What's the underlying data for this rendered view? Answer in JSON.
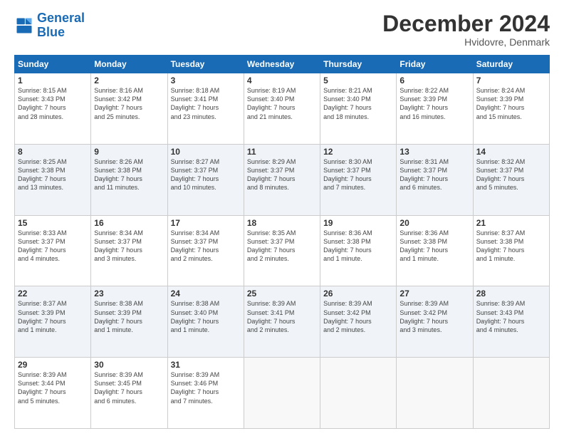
{
  "header": {
    "logo_line1": "General",
    "logo_line2": "Blue",
    "month_title": "December 2024",
    "location": "Hvidovre, Denmark"
  },
  "weekdays": [
    "Sunday",
    "Monday",
    "Tuesday",
    "Wednesday",
    "Thursday",
    "Friday",
    "Saturday"
  ],
  "weeks": [
    [
      {
        "day": "1",
        "info": "Sunrise: 8:15 AM\nSunset: 3:43 PM\nDaylight: 7 hours\nand 28 minutes."
      },
      {
        "day": "2",
        "info": "Sunrise: 8:16 AM\nSunset: 3:42 PM\nDaylight: 7 hours\nand 25 minutes."
      },
      {
        "day": "3",
        "info": "Sunrise: 8:18 AM\nSunset: 3:41 PM\nDaylight: 7 hours\nand 23 minutes."
      },
      {
        "day": "4",
        "info": "Sunrise: 8:19 AM\nSunset: 3:40 PM\nDaylight: 7 hours\nand 21 minutes."
      },
      {
        "day": "5",
        "info": "Sunrise: 8:21 AM\nSunset: 3:40 PM\nDaylight: 7 hours\nand 18 minutes."
      },
      {
        "day": "6",
        "info": "Sunrise: 8:22 AM\nSunset: 3:39 PM\nDaylight: 7 hours\nand 16 minutes."
      },
      {
        "day": "7",
        "info": "Sunrise: 8:24 AM\nSunset: 3:39 PM\nDaylight: 7 hours\nand 15 minutes."
      }
    ],
    [
      {
        "day": "8",
        "info": "Sunrise: 8:25 AM\nSunset: 3:38 PM\nDaylight: 7 hours\nand 13 minutes."
      },
      {
        "day": "9",
        "info": "Sunrise: 8:26 AM\nSunset: 3:38 PM\nDaylight: 7 hours\nand 11 minutes."
      },
      {
        "day": "10",
        "info": "Sunrise: 8:27 AM\nSunset: 3:37 PM\nDaylight: 7 hours\nand 10 minutes."
      },
      {
        "day": "11",
        "info": "Sunrise: 8:29 AM\nSunset: 3:37 PM\nDaylight: 7 hours\nand 8 minutes."
      },
      {
        "day": "12",
        "info": "Sunrise: 8:30 AM\nSunset: 3:37 PM\nDaylight: 7 hours\nand 7 minutes."
      },
      {
        "day": "13",
        "info": "Sunrise: 8:31 AM\nSunset: 3:37 PM\nDaylight: 7 hours\nand 6 minutes."
      },
      {
        "day": "14",
        "info": "Sunrise: 8:32 AM\nSunset: 3:37 PM\nDaylight: 7 hours\nand 5 minutes."
      }
    ],
    [
      {
        "day": "15",
        "info": "Sunrise: 8:33 AM\nSunset: 3:37 PM\nDaylight: 7 hours\nand 4 minutes."
      },
      {
        "day": "16",
        "info": "Sunrise: 8:34 AM\nSunset: 3:37 PM\nDaylight: 7 hours\nand 3 minutes."
      },
      {
        "day": "17",
        "info": "Sunrise: 8:34 AM\nSunset: 3:37 PM\nDaylight: 7 hours\nand 2 minutes."
      },
      {
        "day": "18",
        "info": "Sunrise: 8:35 AM\nSunset: 3:37 PM\nDaylight: 7 hours\nand 2 minutes."
      },
      {
        "day": "19",
        "info": "Sunrise: 8:36 AM\nSunset: 3:38 PM\nDaylight: 7 hours\nand 1 minute."
      },
      {
        "day": "20",
        "info": "Sunrise: 8:36 AM\nSunset: 3:38 PM\nDaylight: 7 hours\nand 1 minute."
      },
      {
        "day": "21",
        "info": "Sunrise: 8:37 AM\nSunset: 3:38 PM\nDaylight: 7 hours\nand 1 minute."
      }
    ],
    [
      {
        "day": "22",
        "info": "Sunrise: 8:37 AM\nSunset: 3:39 PM\nDaylight: 7 hours\nand 1 minute."
      },
      {
        "day": "23",
        "info": "Sunrise: 8:38 AM\nSunset: 3:39 PM\nDaylight: 7 hours\nand 1 minute."
      },
      {
        "day": "24",
        "info": "Sunrise: 8:38 AM\nSunset: 3:40 PM\nDaylight: 7 hours\nand 1 minute."
      },
      {
        "day": "25",
        "info": "Sunrise: 8:39 AM\nSunset: 3:41 PM\nDaylight: 7 hours\nand 2 minutes."
      },
      {
        "day": "26",
        "info": "Sunrise: 8:39 AM\nSunset: 3:42 PM\nDaylight: 7 hours\nand 2 minutes."
      },
      {
        "day": "27",
        "info": "Sunrise: 8:39 AM\nSunset: 3:42 PM\nDaylight: 7 hours\nand 3 minutes."
      },
      {
        "day": "28",
        "info": "Sunrise: 8:39 AM\nSunset: 3:43 PM\nDaylight: 7 hours\nand 4 minutes."
      }
    ],
    [
      {
        "day": "29",
        "info": "Sunrise: 8:39 AM\nSunset: 3:44 PM\nDaylight: 7 hours\nand 5 minutes."
      },
      {
        "day": "30",
        "info": "Sunrise: 8:39 AM\nSunset: 3:45 PM\nDaylight: 7 hours\nand 6 minutes."
      },
      {
        "day": "31",
        "info": "Sunrise: 8:39 AM\nSunset: 3:46 PM\nDaylight: 7 hours\nand 7 minutes."
      },
      {
        "day": "",
        "info": ""
      },
      {
        "day": "",
        "info": ""
      },
      {
        "day": "",
        "info": ""
      },
      {
        "day": "",
        "info": ""
      }
    ]
  ]
}
